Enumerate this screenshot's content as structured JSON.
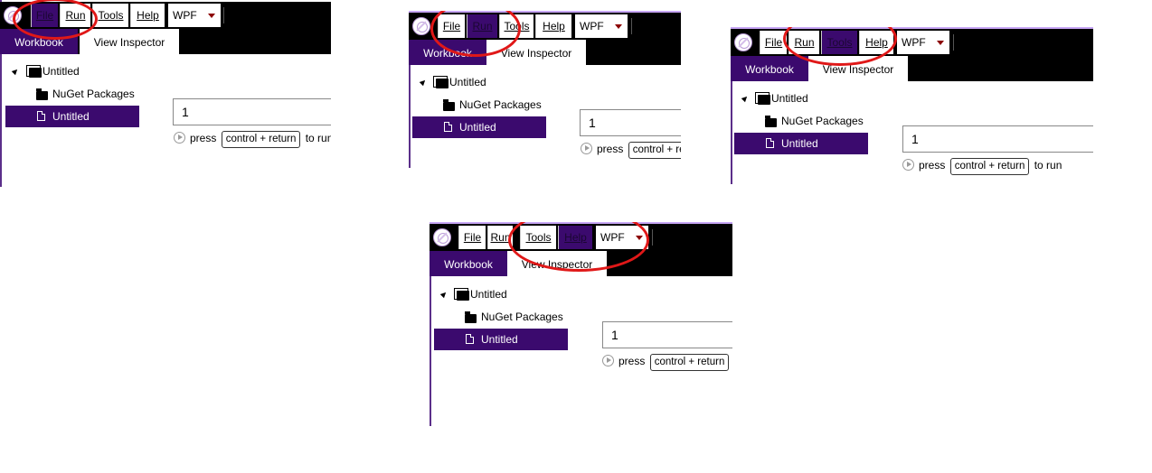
{
  "menu": {
    "file": "File",
    "run": "Run",
    "tools": "Tools",
    "help": "Help",
    "platform": "WPF"
  },
  "tabs": {
    "workbook": "Workbook",
    "inspector": "View Inspector"
  },
  "tree": {
    "root": "Untitled",
    "packages": "NuGet Packages",
    "selected": "Untitled"
  },
  "editor": {
    "value": "1"
  },
  "hint": {
    "prefix": "press",
    "shortcut": "control + return",
    "suffix": "to run"
  },
  "hint_truncated": {
    "panel1_shortcut_tail": "to run",
    "panel2_shortcut": "control + re"
  },
  "colors": {
    "accent": "#3b0a6e",
    "highlight_ring": "#e01818",
    "chrome": "#000000"
  },
  "icons": [
    "app-logo-icon",
    "expander-icon",
    "folder-stack-icon",
    "folder-icon",
    "document-icon",
    "play-icon",
    "dropdown-caret-icon"
  ]
}
